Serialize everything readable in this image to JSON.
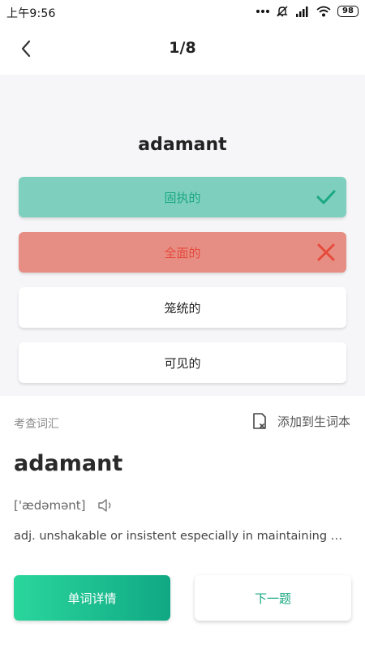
{
  "status_bar": {
    "time": "上午9:56",
    "battery": "98",
    "icons": [
      "more-dots-icon",
      "mute-icon",
      "signal-icon",
      "wifi-icon",
      "battery-icon"
    ]
  },
  "header": {
    "back_icon": "chevron-left-icon",
    "counter": "1/8"
  },
  "quiz": {
    "word": "adamant",
    "options": [
      {
        "label": "固执的",
        "state": "correct",
        "icon": "check-icon"
      },
      {
        "label": "全面的",
        "state": "wrong",
        "icon": "cross-icon"
      },
      {
        "label": "笼统的",
        "state": "neutral"
      },
      {
        "label": "可见的",
        "state": "neutral"
      }
    ]
  },
  "detail": {
    "section_label": "考查词汇",
    "add_vocab_label": "添加到生词本",
    "word": "adamant",
    "phonetic": "['ædəmənt]",
    "definition": "adj. unshakable or insistent especially in maintaining a position or opinion",
    "details_button": "单词详情",
    "next_button": "下一题"
  },
  "colors": {
    "accent": "#1aa882",
    "correct_bg": "#7ecfbd",
    "wrong_bg": "#e78e84",
    "wrong_text": "#e64a3b"
  }
}
